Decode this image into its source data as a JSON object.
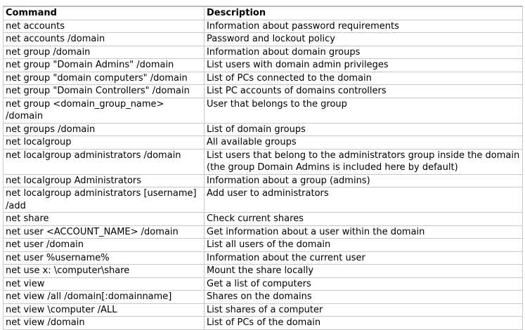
{
  "table": {
    "headers": [
      "Command",
      "Description"
    ],
    "rows": [
      [
        "net accounts",
        "Information about password requirements"
      ],
      [
        "net accounts /domain",
        "Password and lockout policy"
      ],
      [
        "net group /domain",
        "Information about domain groups"
      ],
      [
        "net group \"Domain Admins\" /domain",
        "List users with domain admin privileges"
      ],
      [
        "net group \"domain computers\" /domain",
        "List of PCs connected to the domain"
      ],
      [
        "net group \"Domain Controllers\" /domain",
        "List PC accounts of domains controllers"
      ],
      [
        "net group <domain_group_name> /domain",
        "User that belongs to the group"
      ],
      [
        "net groups /domain",
        "List of domain groups"
      ],
      [
        "net localgroup",
        "All available groups"
      ],
      [
        "net localgroup administrators /domain",
        "List users that belong to the administrators group inside the domain (the group Domain Admins is included here by default)"
      ],
      [
        "net localgroup Administrators",
        "Information about a group (admins)"
      ],
      [
        "net localgroup administrators [username] /add",
        "Add user to administrators"
      ],
      [
        "net share",
        "Check current shares"
      ],
      [
        "net user <ACCOUNT_NAME> /domain",
        "Get information about a user within the domain"
      ],
      [
        "net user /domain",
        "List all users of the domain"
      ],
      [
        "net user %username%",
        "Information about the current user"
      ],
      [
        "net use x: \\computer\\share",
        "Mount the share locally"
      ],
      [
        "net view",
        "Get a list of computers"
      ],
      [
        "net view /all /domain[:domainname]",
        "Shares on the domains"
      ],
      [
        "net view \\computer /ALL",
        "List shares of a computer"
      ],
      [
        "net view /domain",
        "List of PCs of the domain"
      ]
    ]
  }
}
